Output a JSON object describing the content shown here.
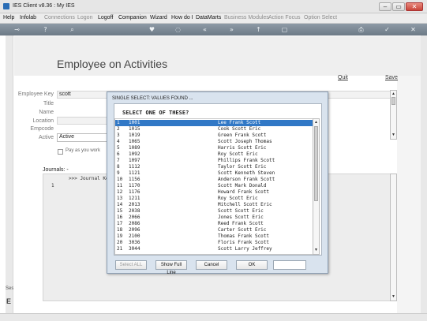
{
  "window": {
    "title": "IES Client v8.36 : My IES",
    "controls": [
      "–",
      "▭",
      "✕"
    ]
  },
  "menu": [
    {
      "label": "Help",
      "enabled": true
    },
    {
      "label": "Infolab",
      "enabled": true
    },
    {
      "label": "Connections",
      "enabled": false
    },
    {
      "label": "Logon",
      "enabled": false
    },
    {
      "label": "Logoff",
      "enabled": true
    },
    {
      "label": "Companion",
      "enabled": true
    },
    {
      "label": "Wizard",
      "enabled": true
    },
    {
      "label": "How do I",
      "enabled": true
    },
    {
      "label": "DataMarts",
      "enabled": true
    },
    {
      "label": "Business Modules",
      "enabled": false
    },
    {
      "label": "Action Focus",
      "enabled": false
    },
    {
      "label": "Option Select",
      "enabled": false
    }
  ],
  "toolbar": {
    "icons": [
      "key-icon",
      "help-icon",
      "search-icon",
      "heart-icon",
      "refresh-icon",
      "back-icon",
      "forward-icon",
      "up-icon",
      "stop-icon",
      "print-icon",
      "check-icon",
      "close-icon"
    ],
    "glyphs": [
      "⊸",
      "?",
      "⌕",
      "♥",
      "◌",
      "«",
      "»",
      "↑",
      "▢",
      "⎙",
      "✓",
      "✕"
    ]
  },
  "page": {
    "title": "Employee on Activities",
    "quit_label": "Quit",
    "save_label": "Save"
  },
  "form": {
    "employee_key_label": "Employee Key",
    "employee_key_value": "scott",
    "title_label": "Title",
    "name_label": "Name",
    "location_label": "Location",
    "empcode_label": "Empcode",
    "active_label": "Active",
    "active_value": "Active",
    "pay_as_you_work_label": "Pay as you work",
    "pay_as_you_work_checked": false
  },
  "journals": {
    "label": "Journals: -",
    "header": ">>> Journal Key N",
    "line_number": "1"
  },
  "left_strip": {
    "label": "Ses",
    "glyph": "E"
  },
  "dialog": {
    "title": "SINGLE SELECT: VALUES FOUND ...",
    "prompt": "SELECT ONE OF THESE?",
    "rows": [
      {
        "n": "1",
        "code": "1001",
        "name": "Lee Frank Scott"
      },
      {
        "n": "2",
        "code": "1015",
        "name": "Cook Scott Eric"
      },
      {
        "n": "3",
        "code": "1019",
        "name": "Green Frank Scott"
      },
      {
        "n": "4",
        "code": "1065",
        "name": "Scott Joseph Thomas"
      },
      {
        "n": "5",
        "code": "1089",
        "name": "Harris Scott Eric"
      },
      {
        "n": "6",
        "code": "1092",
        "name": "Roy Scott Eric"
      },
      {
        "n": "7",
        "code": "1097",
        "name": "Phillips Frank Scott"
      },
      {
        "n": "8",
        "code": "1112",
        "name": "Taylor Scott Eric"
      },
      {
        "n": "9",
        "code": "1121",
        "name": "Scott Kenneth Steven"
      },
      {
        "n": "10",
        "code": "1156",
        "name": "Anderson Frank Scott"
      },
      {
        "n": "11",
        "code": "1170",
        "name": "Scott Mark Donald"
      },
      {
        "n": "12",
        "code": "1176",
        "name": "Howard Frank Scott"
      },
      {
        "n": "13",
        "code": "1211",
        "name": "Roy Scott Eric"
      },
      {
        "n": "14",
        "code": "2013",
        "name": "Mitchell Scott Eric"
      },
      {
        "n": "15",
        "code": "2038",
        "name": "Scott Scott Eric"
      },
      {
        "n": "16",
        "code": "2066",
        "name": "Jones Scott Eric"
      },
      {
        "n": "17",
        "code": "2086",
        "name": "Reed Frank Scott"
      },
      {
        "n": "18",
        "code": "2096",
        "name": "Carter Scott Eric"
      },
      {
        "n": "19",
        "code": "2100",
        "name": "Thomas Frank Scott"
      },
      {
        "n": "20",
        "code": "3036",
        "name": "Floris Frank Scott"
      },
      {
        "n": "21",
        "code": "3044",
        "name": "Scott Larry Jeffrey"
      }
    ],
    "selected_index": 0,
    "buttons": {
      "select_all": "Select ALL",
      "show_full_line": "Show Full Line",
      "cancel": "Cancel",
      "ok": "OK"
    }
  }
}
